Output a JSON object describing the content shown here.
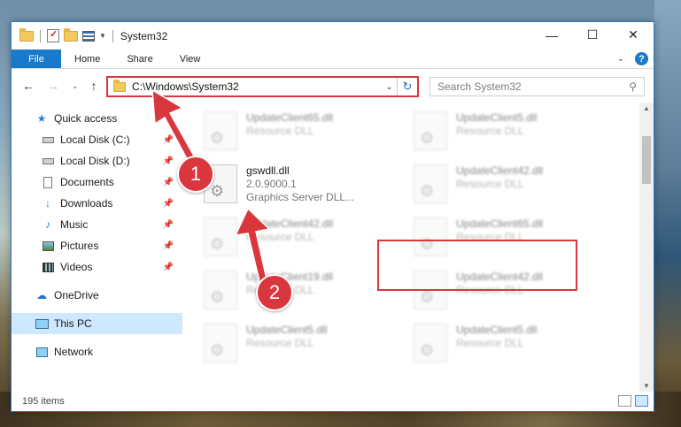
{
  "window": {
    "title": "System32"
  },
  "titlebar": {
    "minimize": "—",
    "maximize": "☐",
    "close": "✕"
  },
  "ribbon": {
    "tabs": [
      "File",
      "Home",
      "Share",
      "View"
    ],
    "expand_icon": "chevron-down-icon",
    "help_label": "?"
  },
  "address": {
    "path": "C:\\Windows\\System32",
    "search_placeholder": "Search System32"
  },
  "nav_pane": {
    "items": [
      {
        "label": "Quick access",
        "icon": "star-icon",
        "pinned": false
      },
      {
        "label": "Local Disk (C:)",
        "icon": "drive-icon",
        "pinned": true
      },
      {
        "label": "Local Disk (D:)",
        "icon": "drive-icon",
        "pinned": true
      },
      {
        "label": "Documents",
        "icon": "documents-icon",
        "pinned": true
      },
      {
        "label": "Downloads",
        "icon": "download-icon",
        "pinned": true
      },
      {
        "label": "Music",
        "icon": "music-icon",
        "pinned": true
      },
      {
        "label": "Pictures",
        "icon": "pictures-icon",
        "pinned": true
      },
      {
        "label": "Videos",
        "icon": "videos-icon",
        "pinned": true
      },
      {
        "label": "OneDrive",
        "icon": "cloud-icon"
      },
      {
        "label": "This PC",
        "icon": "computer-icon",
        "selected": true
      },
      {
        "label": "Network",
        "icon": "network-icon"
      }
    ]
  },
  "files": [
    {
      "name": "UpdateClient65.dll",
      "line2": "Resource DLL",
      "blurred": true
    },
    {
      "name": "UpdateClient5.dll",
      "line2": "Resource DLL",
      "blurred": true
    },
    {
      "name": "gswdll.dll",
      "line2": "2.0.9000.1",
      "line3": "Graphics Server DLL...",
      "blurred": false
    },
    {
      "name": "UpdateClient42.dll",
      "line2": "Resource DLL",
      "blurred": true
    },
    {
      "name": "UpdateClient42.dll",
      "line2": "Resource DLL",
      "blurred": true
    },
    {
      "name": "UpdateClient65.dll",
      "line2": "Resource DLL",
      "blurred": true
    },
    {
      "name": "UpdateClient19.dll",
      "line2": "Resource DLL",
      "blurred": true
    },
    {
      "name": "UpdateClient42.dll",
      "line2": "Resource DLL",
      "blurred": true
    },
    {
      "name": "UpdateClient5.dll",
      "line2": "Resource DLL",
      "blurred": true
    },
    {
      "name": "UpdateClient5.dll",
      "line2": "Resource DLL",
      "blurred": true
    }
  ],
  "status": {
    "item_count": "195 items"
  },
  "annotations": {
    "badge1": "1",
    "badge2": "2",
    "color": "#d9363e"
  }
}
